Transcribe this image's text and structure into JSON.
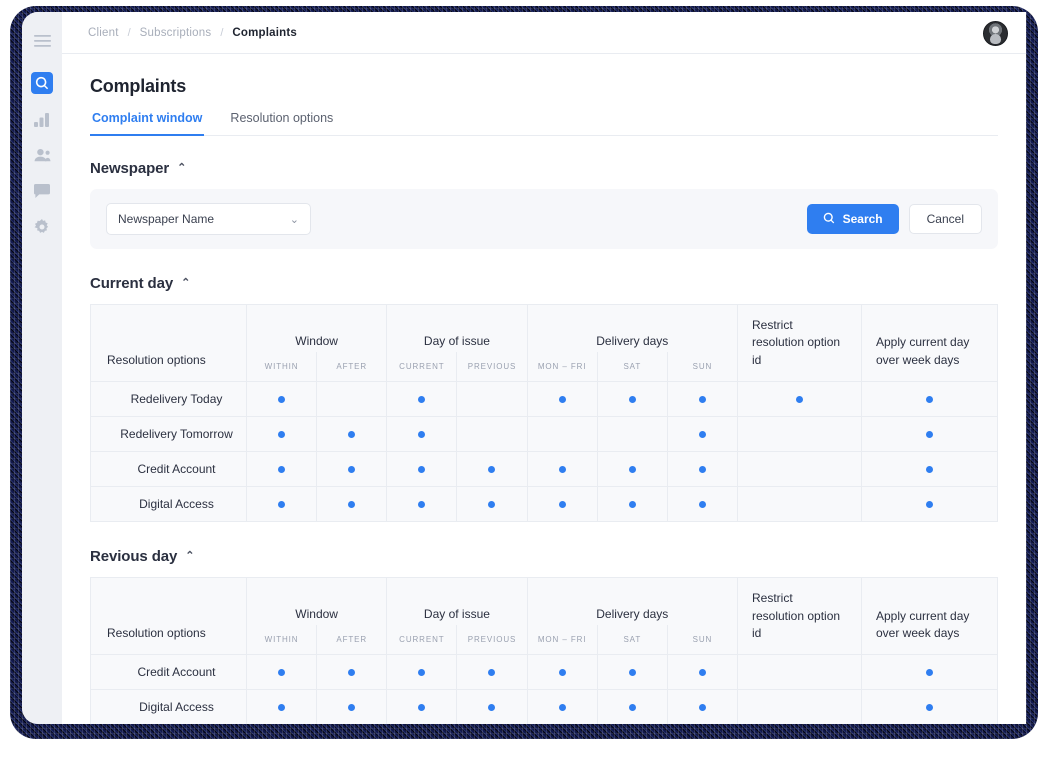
{
  "sidebar": {
    "items": [
      {
        "name": "hamburger-menu",
        "icon": "hamburger-icon",
        "active": false
      },
      {
        "name": "search",
        "icon": "search-icon",
        "active": true
      },
      {
        "name": "analytics",
        "icon": "bar-chart-icon",
        "active": false
      },
      {
        "name": "users",
        "icon": "people-icon",
        "active": false
      },
      {
        "name": "messages",
        "icon": "chat-icon",
        "active": false
      },
      {
        "name": "settings",
        "icon": "gear-icon",
        "active": false
      }
    ]
  },
  "topbar": {
    "breadcrumb": [
      "Client",
      "Subscriptions",
      "Complaints"
    ],
    "separator": "/",
    "avatar_alt": "user-avatar"
  },
  "page": {
    "title": "Complaints",
    "tabs": [
      {
        "label": "Complaint window",
        "active": true
      },
      {
        "label": "Resolution options",
        "active": false
      }
    ]
  },
  "newspaper_section": {
    "heading": "Newspaper",
    "caret": "⌃",
    "select": {
      "value": "Newspaper Name",
      "chevron": "⌄"
    },
    "search_label": "Search",
    "cancel_label": "Cancel"
  },
  "table_headers": {
    "resolution_options": "Resolution options",
    "window": "Window",
    "window_sub": [
      "WITHIN",
      "AFTER"
    ],
    "day_of_issue": "Day of issue",
    "day_of_issue_sub": [
      "CURRENT",
      "PREVIOUS"
    ],
    "delivery_days": "Delivery days",
    "delivery_days_sub": [
      "MON – FRI",
      "SAT",
      "SUN"
    ],
    "restrict": "Restrict resolution option id",
    "apply": "Apply current day over week days"
  },
  "current_day": {
    "heading": "Current day",
    "caret": "⌃",
    "rows": [
      {
        "name": "Redelivery Today",
        "within": true,
        "after": false,
        "current": true,
        "previous": false,
        "mon_fri": true,
        "sat": true,
        "sun": true,
        "restrict": true,
        "apply": true
      },
      {
        "name": "Redelivery Tomorrow",
        "within": true,
        "after": true,
        "current": true,
        "previous": false,
        "mon_fri": false,
        "sat": false,
        "sun": true,
        "restrict": false,
        "apply": true
      },
      {
        "name": "Credit Account",
        "within": true,
        "after": true,
        "current": true,
        "previous": true,
        "mon_fri": true,
        "sat": true,
        "sun": true,
        "restrict": false,
        "apply": true
      },
      {
        "name": "Digital Access",
        "within": true,
        "after": true,
        "current": true,
        "previous": true,
        "mon_fri": true,
        "sat": true,
        "sun": true,
        "restrict": false,
        "apply": true
      }
    ]
  },
  "previous_day": {
    "heading": "Revious day",
    "caret": "⌃",
    "rows": [
      {
        "name": "Credit Account",
        "within": true,
        "after": true,
        "current": true,
        "previous": true,
        "mon_fri": true,
        "sat": true,
        "sun": true,
        "restrict": false,
        "apply": true
      },
      {
        "name": "Digital Access",
        "within": true,
        "after": true,
        "current": true,
        "previous": true,
        "mon_fri": true,
        "sat": true,
        "sun": true,
        "restrict": false,
        "apply": true
      }
    ]
  },
  "colors": {
    "accent": "#2f7ef0",
    "dot": "#2f7ef0",
    "text_dark": "#2b3040",
    "text_muted": "#9aa1b0",
    "panel_bg": "#f6f7fa",
    "table_bg": "#f8f9fb",
    "border": "#e9ecf1",
    "sidebar_bg": "#eef0f4"
  }
}
